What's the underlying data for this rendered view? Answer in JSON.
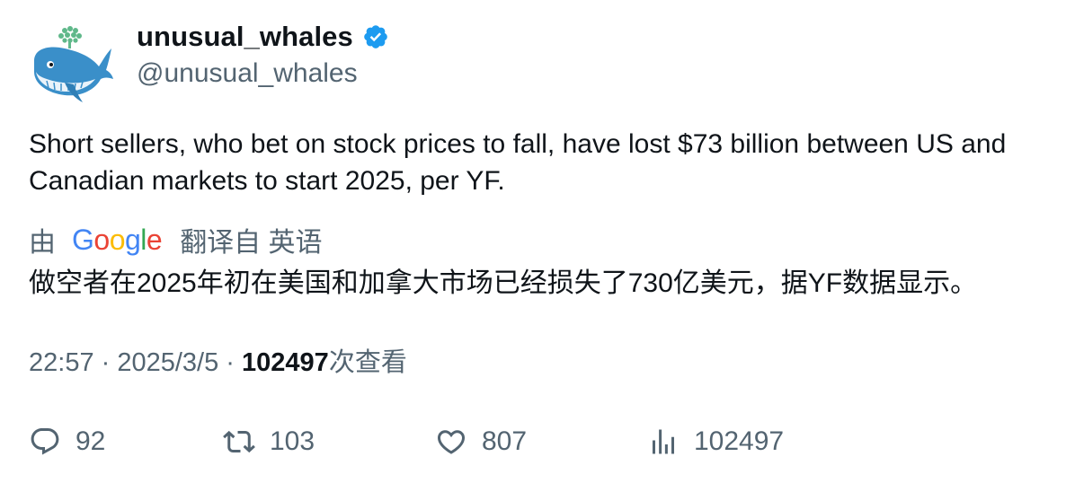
{
  "author": {
    "display_name": "unusual_whales",
    "handle": "@unusual_whales",
    "verified_icon": "verified-badge-icon",
    "verified_color": "#1d9bf0"
  },
  "tweet": {
    "text": "Short sellers, who bet on stock prices to fall, have lost $73 billion between US and Canadian markets to start 2025, per YF."
  },
  "translation": {
    "prefix": "由",
    "provider_letters": [
      "G",
      "o",
      "o",
      "g",
      "l",
      "e"
    ],
    "provider_colors": [
      "#4285F4",
      "#EA4335",
      "#FBBC05",
      "#4285F4",
      "#34A853",
      "#EA4335"
    ],
    "suffix": "翻译自 英语",
    "text": "做空者在2025年初在美国和加拿大市场已经损失了730亿美元，据YF数据显示。"
  },
  "meta": {
    "time": "22:57",
    "separator": " · ",
    "date": "2025/3/5",
    "views_count": "102497",
    "views_label": "次查看"
  },
  "actions": {
    "replies": "92",
    "retweets": "103",
    "likes": "807",
    "views": "102497"
  },
  "colors": {
    "text_primary": "#0f1419",
    "text_secondary": "#536471"
  }
}
